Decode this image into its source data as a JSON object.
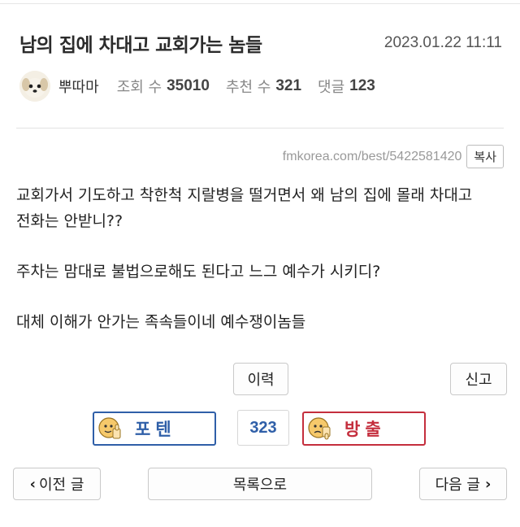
{
  "post": {
    "title": "남의 집에 차대고 교회가는 놈들",
    "date": "2023.01.22 11:11",
    "author": "뿌따마",
    "views_label": "조회 수",
    "views": "35010",
    "recommend_label": "추천 수",
    "recommend": "321",
    "comments_label": "댓글",
    "comments": "123",
    "url": "fmkorea.com/best/5422581420",
    "copy_label": "복사"
  },
  "content": {
    "paragraphs": [
      "교회가서 기도하고 착한척 지랄병을 떨거면서 왜 남의 집에 몰래 차대고 전화는 안받니??",
      "주차는 맘대로 불법으로해도 된다고 느그 예수가 시키디?",
      "대체 이해가 안가는 족속들이네 예수쟁이놈들"
    ]
  },
  "actions": {
    "history_label": "이력",
    "report_label": "신고",
    "upvote_label": "포텐",
    "vote_count": "323",
    "downvote_label": "방출",
    "prev_label": "이전 글",
    "list_label": "목록으로",
    "next_label": "다음 글"
  },
  "icons": {
    "avatar": "puppy-avatar-icon",
    "upvote": "thumbs-up-face-icon",
    "downvote": "thumbs-down-face-icon",
    "prev": "chevron-left-icon",
    "next": "chevron-right-icon"
  },
  "colors": {
    "upvote": "#2f5fa8",
    "downvote": "#c42e3d"
  }
}
